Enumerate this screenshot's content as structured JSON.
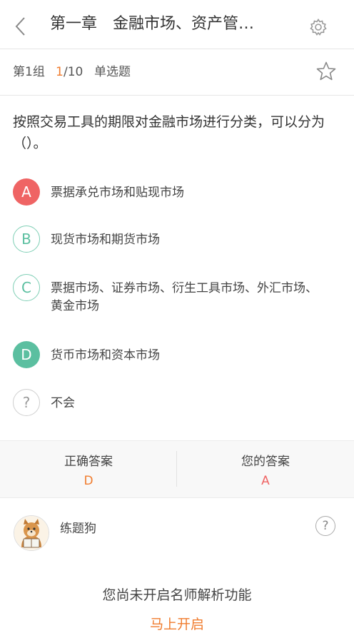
{
  "header": {
    "title": "第一章　金融市场、资产管…",
    "back_icon": "chevron-left-icon",
    "settings_icon": "gear-icon"
  },
  "subheader": {
    "group": "第1组",
    "progress_current": "1",
    "progress_total": "/10",
    "question_type": "单选题",
    "favorite_icon": "star-outline-icon"
  },
  "question": {
    "text": "按照交易工具的期限对金融市场进行分类，可以分为（）。"
  },
  "options": [
    {
      "letter": "A",
      "text": "票据承兑市场和贴现市场",
      "state": "wrong"
    },
    {
      "letter": "B",
      "text": "现货市场和期货市场",
      "state": "normal"
    },
    {
      "letter": "C",
      "text": "票据市场、证券市场、衍生工具市场、外汇市场、黄金市场",
      "state": "normal"
    },
    {
      "letter": "D",
      "text": "货币市场和资本市场",
      "state": "correct"
    },
    {
      "letter": "?",
      "text": "不会",
      "state": "unknown"
    }
  ],
  "answers": {
    "correct_label": "正确答案",
    "correct_value": "D",
    "yours_label": "您的答案",
    "yours_value": "A"
  },
  "colors": {
    "accent": "#f07c2e",
    "wrong": "#ef6464",
    "correct": "#5bbfa0"
  },
  "teacher": {
    "name": "练题狗",
    "help_icon": "question-circle-icon"
  },
  "analysis": {
    "notice": "您尚未开启名师解析功能",
    "open_label": "马上开启"
  }
}
